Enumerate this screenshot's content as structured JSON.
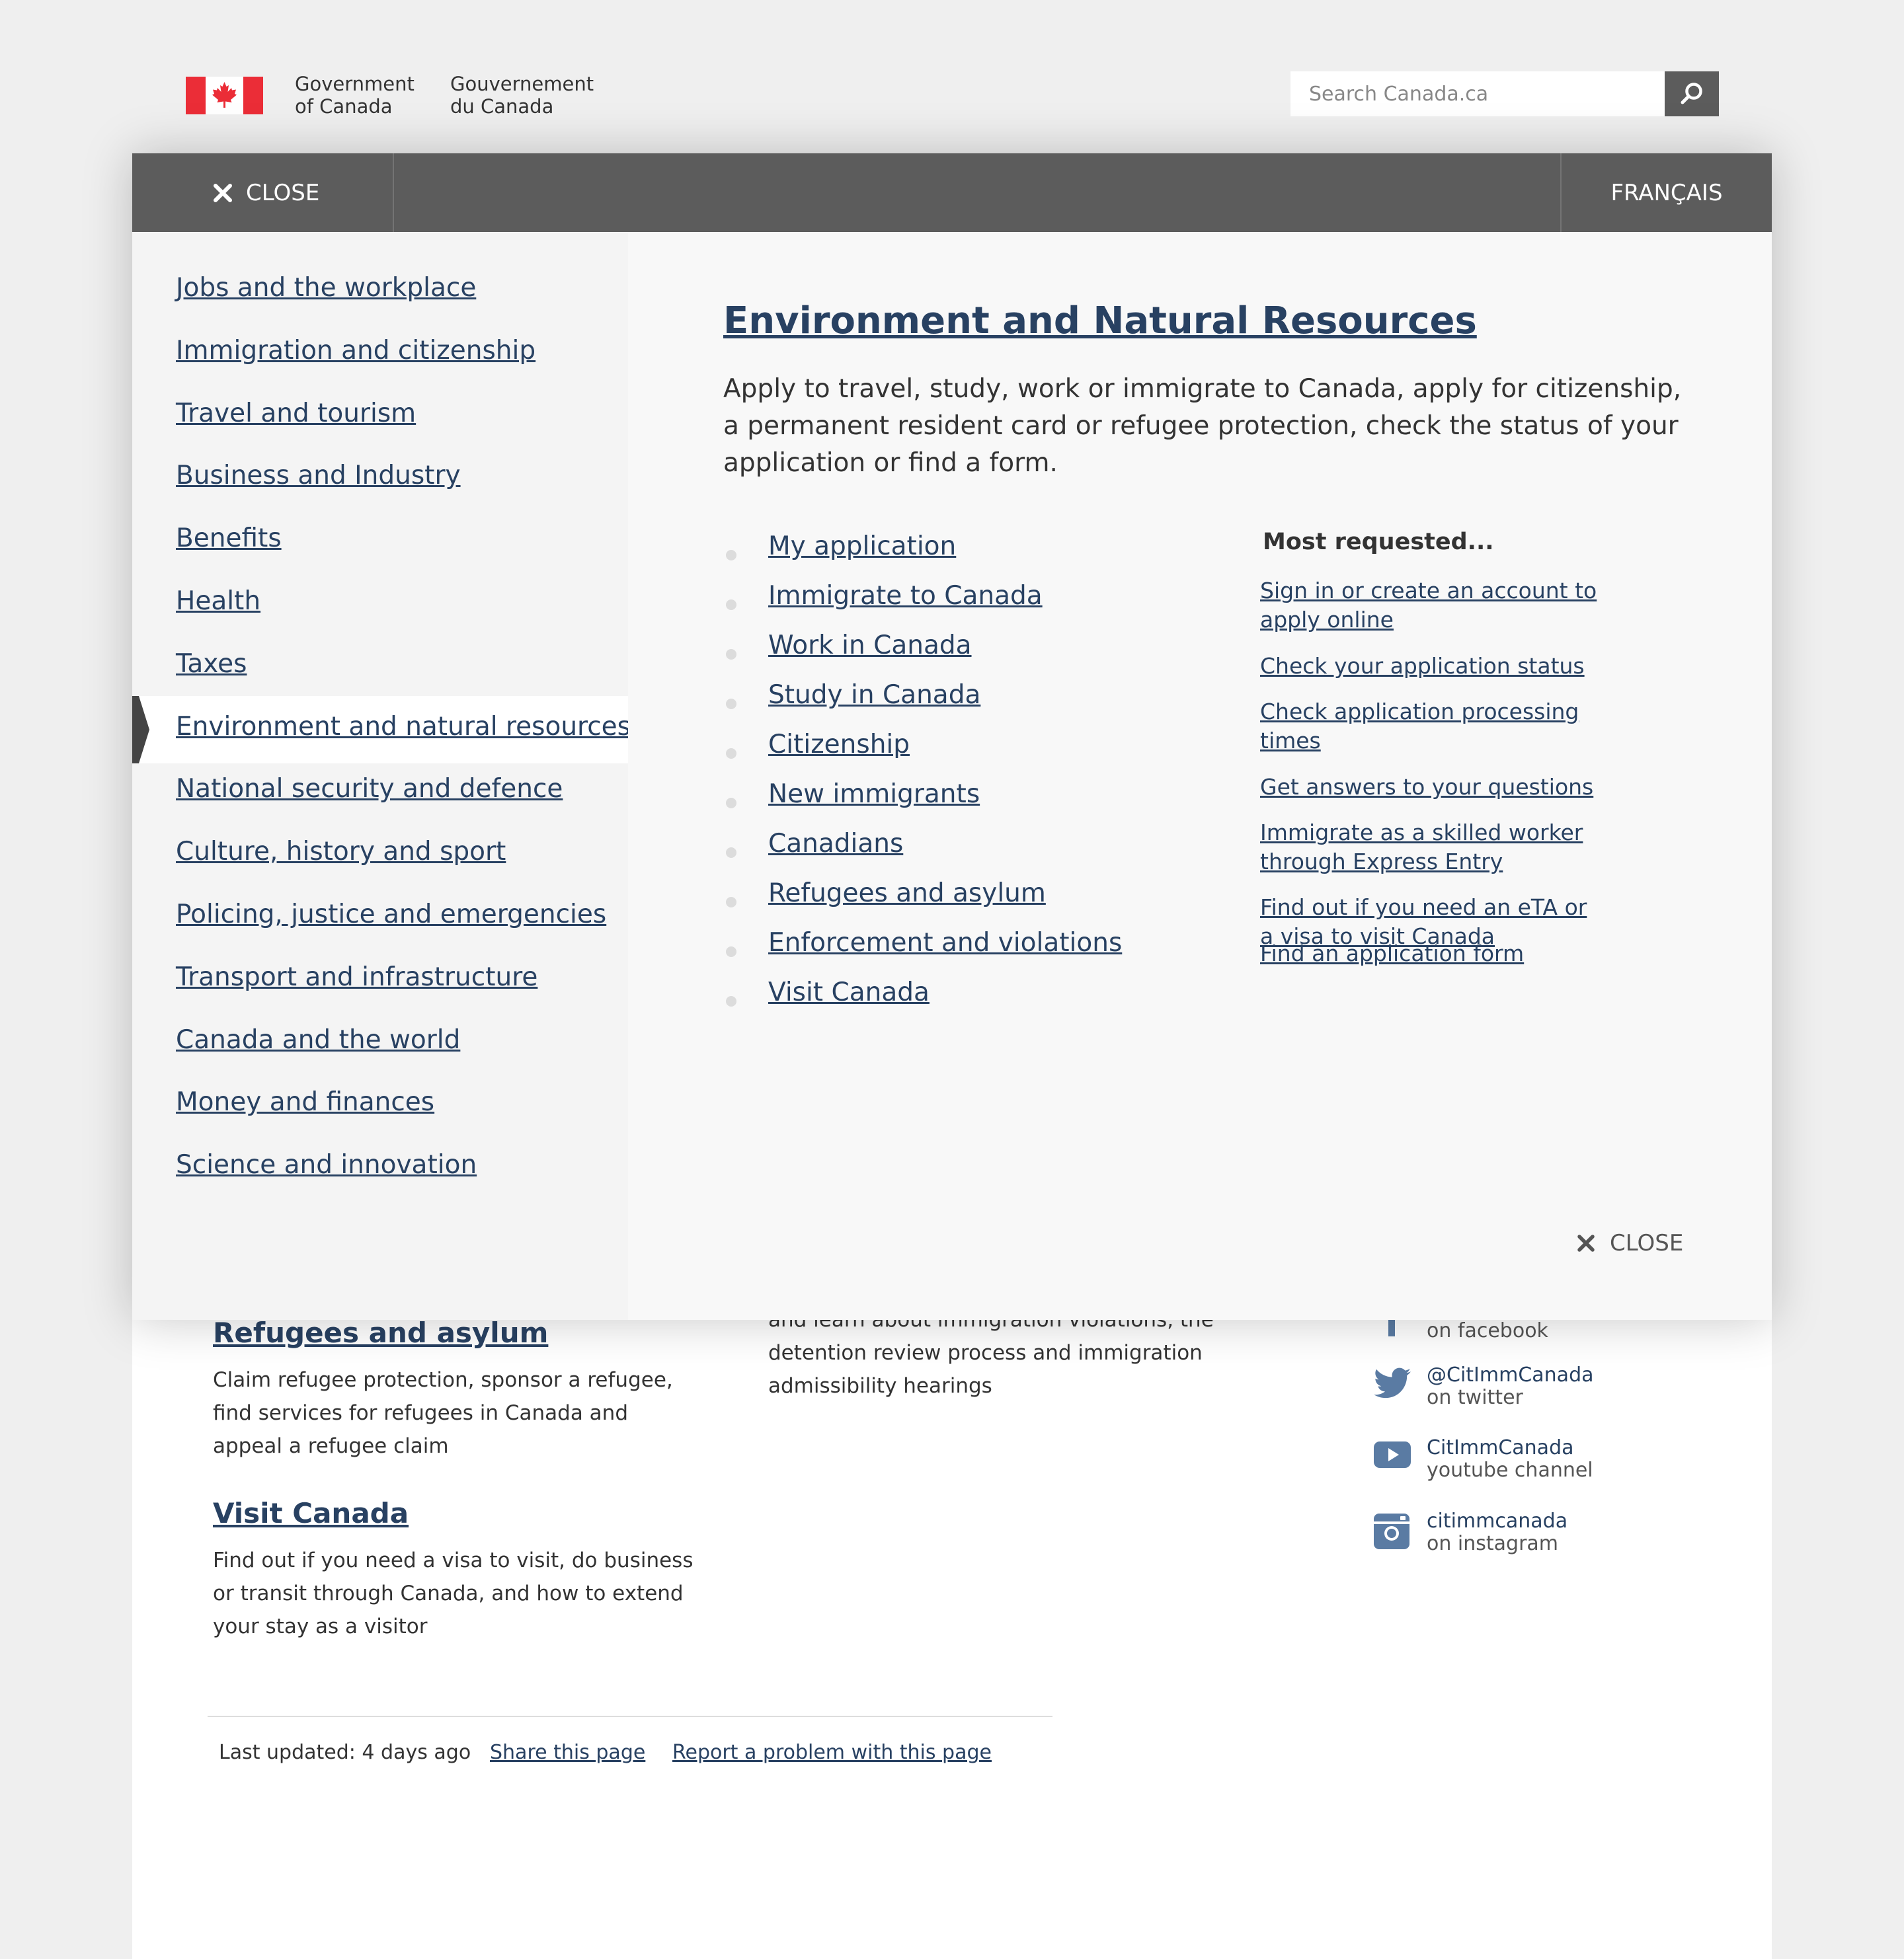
{
  "header": {
    "signature_en": [
      "Government",
      "of Canada"
    ],
    "signature_fr": [
      "Gouvernement",
      "du Canada"
    ],
    "search_placeholder": "Search Canada.ca",
    "flag_color": "#eb2d37",
    "search_icon": "magnifier-icon"
  },
  "menu": {
    "close_label": "CLOSE",
    "language_label": "FRANÇAIS",
    "left_items": [
      "Jobs and the workplace",
      "Immigration and citizenship",
      "Travel and tourism",
      "Business and Industry",
      "Benefits",
      "Health",
      "Taxes",
      "Environment and natural resources",
      "National security and defence",
      "Culture, history and sport",
      "Policing, justice and emergencies",
      "Transport and infrastructure",
      "Canada and the world",
      "Money and finances",
      "Science and innovation"
    ],
    "active_item": "Environment and natural resources",
    "panel_title": "Environment and Natural Resources",
    "panel_description": "Apply to travel, study, work or immigrate to Canada, apply for citizenship, a permanent resident card or refugee protection, check the status of your application or find a form.",
    "sub_items": [
      "My application",
      "Immigrate to Canada",
      "Work in Canada",
      "Study in Canada",
      "Citizenship",
      "New immigrants",
      "Canadians",
      "Refugees and asylum",
      "Enforcement and violations",
      "Visit Canada"
    ],
    "most_requested_heading": "Most requested...",
    "most_requested": [
      "Sign in or create an account to apply online",
      "Check your application status",
      "Check application processing times",
      "Get answers to your questions",
      "Immigrate as a skilled worker through Express Entry",
      "Find out if you need an eTA or a visa to visit Canada",
      "Find an application form"
    ],
    "close_bottom_label": "CLOSE"
  },
  "page": {
    "refugees_title": "Refugees and asylum",
    "refugees_desc": "Claim refugee protection, sponsor a refugee, find services for refugees in Canada and appeal a refugee claim",
    "visit_title": "Visit Canada",
    "visit_desc": "Find out if you need a visa to visit, do business or transit through Canada, and how to extend your stay as a visitor",
    "enforcement_partial": "and learn about immigration violations, the detention review process and immigration admissibility hearings",
    "social": [
      {
        "name": "",
        "sub": "on facebook",
        "icon": "facebook-icon"
      },
      {
        "name": "@CitImmCanada",
        "sub": "on twitter",
        "icon": "twitter-icon"
      },
      {
        "name": "CitImmCanada",
        "sub": "youtube channel",
        "icon": "youtube-icon"
      },
      {
        "name": "citimmcanada",
        "sub": "on instagram",
        "icon": "instagram-icon"
      }
    ],
    "last_updated": "Last updated: 4 days ago",
    "share_label": "Share this page",
    "report_label": "Report a problem with this page"
  }
}
